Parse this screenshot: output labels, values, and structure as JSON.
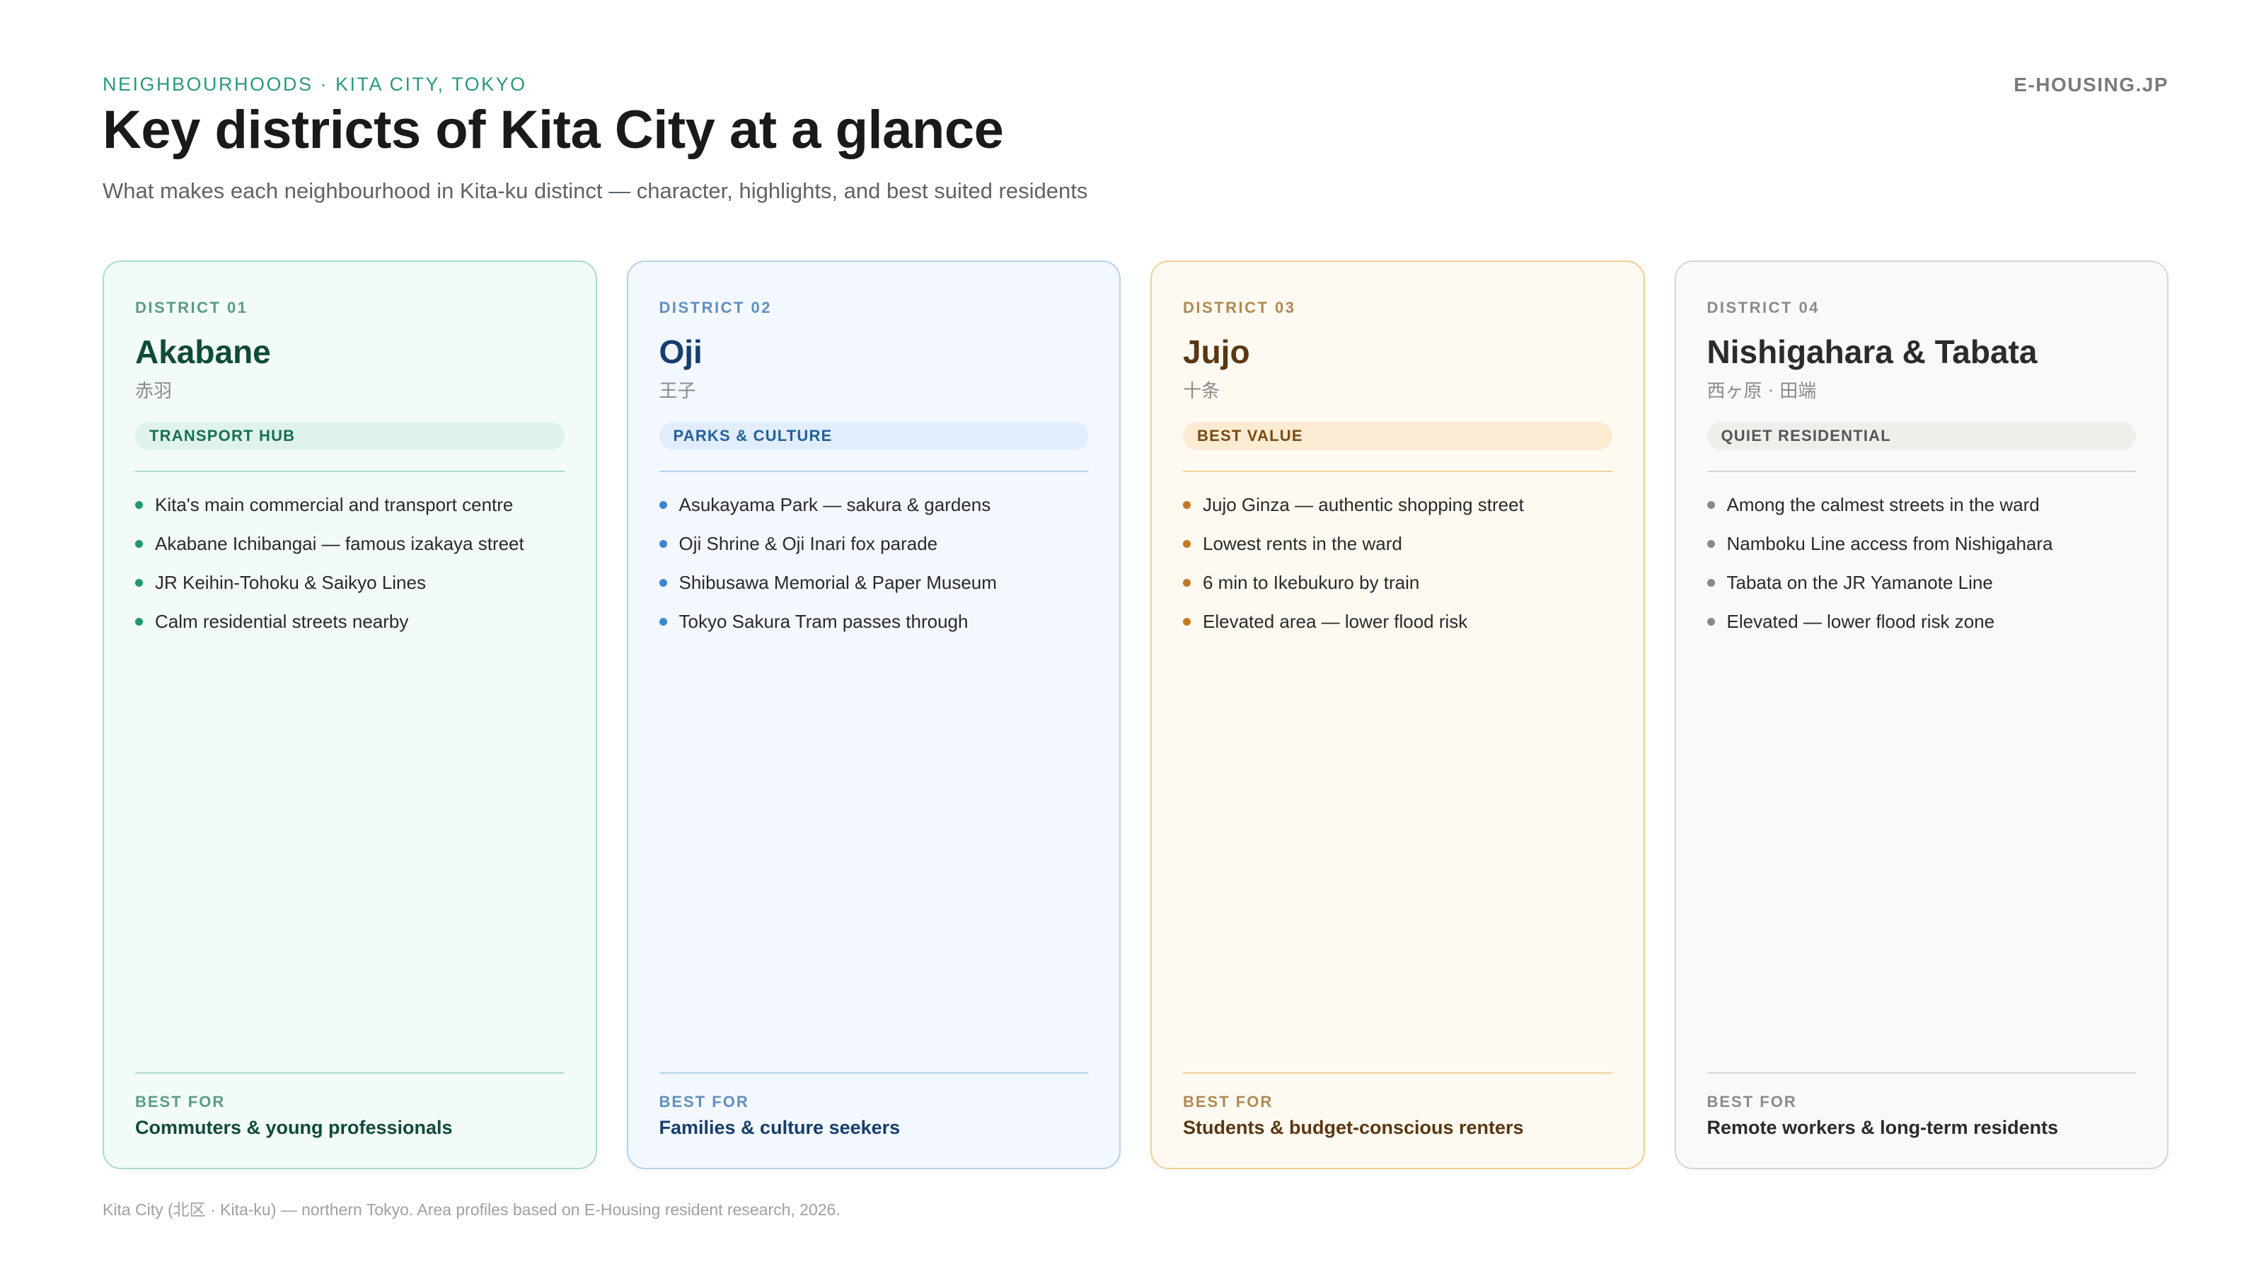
{
  "header": {
    "eyebrow": "NEIGHBOURHOODS · KITA CITY, TOKYO",
    "brand": "E-HOUSING.JP",
    "title": "Key districts of Kita City at a glance",
    "subtitle": "What makes each neighbourhood in Kita-ku distinct — character, highlights, and best suited residents"
  },
  "districts": [
    {
      "label": "DISTRICT 01",
      "name": "Akabane",
      "jp": "赤羽",
      "tag": "TRANSPORT HUB",
      "highlights": [
        "Kita's main commercial and transport centre",
        "Akabane Ichibangai — famous izakaya street",
        "JR Keihin-Tohoku & Saikyo Lines",
        "Calm residential streets nearby"
      ],
      "best_for_label": "BEST FOR",
      "best_for": "Commuters & young professionals",
      "accent": "#1f9a6c"
    },
    {
      "label": "DISTRICT 02",
      "name": "Oji",
      "jp": "王子",
      "tag": "PARKS & CULTURE",
      "highlights": [
        "Asukayama Park — sakura & gardens",
        "Oji Shrine & Oji Inari fox parade",
        "Shibusawa Memorial & Paper Museum",
        "Tokyo Sakura Tram passes through"
      ],
      "best_for_label": "BEST FOR",
      "best_for": "Families & culture seekers",
      "accent": "#3a86d4"
    },
    {
      "label": "DISTRICT 03",
      "name": "Jujo",
      "jp": "十条",
      "tag": "BEST VALUE",
      "highlights": [
        "Jujo Ginza — authentic shopping street",
        "Lowest rents in the ward",
        "6 min to Ikebukuro by train",
        "Elevated area — lower flood risk"
      ],
      "best_for_label": "BEST FOR",
      "best_for": "Students & budget-conscious renters",
      "accent": "#c27a22"
    },
    {
      "label": "DISTRICT 04",
      "name": "Nishigahara & Tabata",
      "jp": "西ヶ原 · 田端",
      "tag": "QUIET RESIDENTIAL",
      "highlights": [
        "Among the calmest streets in the ward",
        "Namboku Line access from Nishigahara",
        "Tabata on the JR Yamanote Line",
        "Elevated — lower flood risk zone"
      ],
      "best_for_label": "BEST FOR",
      "best_for": "Remote workers & long-term residents",
      "accent": "#888888"
    }
  ],
  "footer": "Kita City (北区 · Kita-ku) — northern Tokyo. Area profiles based on E-Housing resident research, 2026."
}
